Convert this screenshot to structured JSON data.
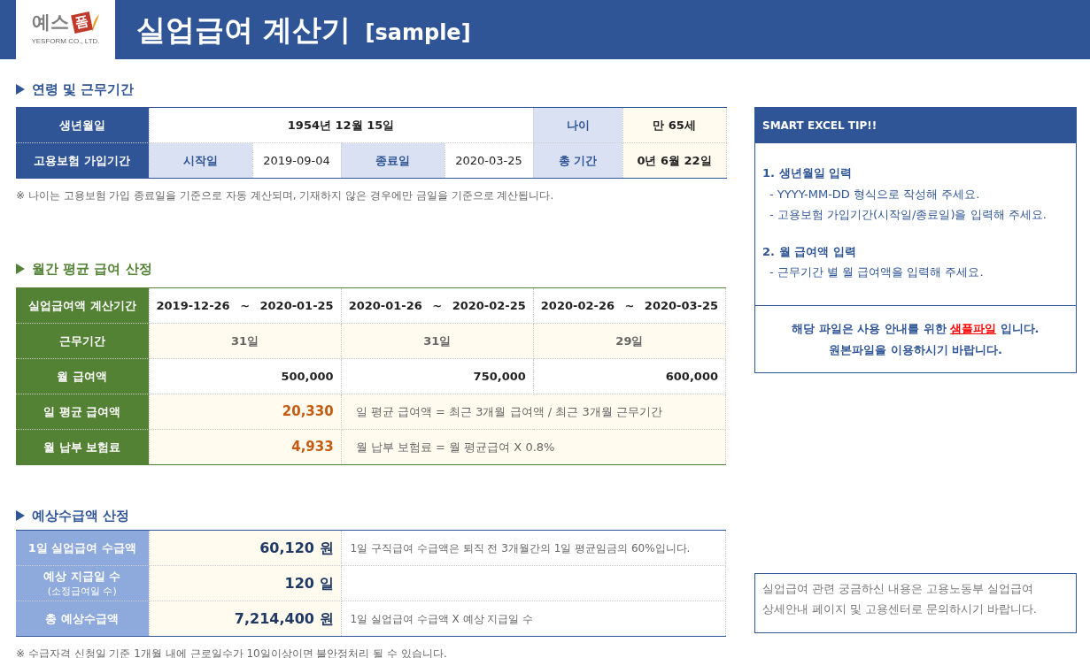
{
  "header": {
    "logo": {
      "text": "예스",
      "stamp": "폼",
      "company": "YESFORM CO., LTD."
    },
    "title": "실업급여 계산기",
    "tag": "[sample]"
  },
  "age_period": {
    "heading": "연령 및 근무기간",
    "birth": {
      "label": "생년월일",
      "value": "1954년 12월 15일"
    },
    "age": {
      "label": "나이",
      "value": "만 65세"
    },
    "period": {
      "label": "고용보험 가입기간",
      "start_label": "시작일",
      "start": "2019-09-04",
      "end_label": "종료일",
      "end": "2020-03-25",
      "total_label": "총 기간",
      "total": "0년 6월 22일"
    },
    "note": "※ 나이는 고용보험 가입 종료일을 기준으로 자동 계산되며, 기재하지 않은 경우에만 금일을 기준으로 계산됩니다."
  },
  "salary": {
    "heading": "월간 평균 급여 산정",
    "period_label": "실업급여액 계산기간",
    "periods": [
      {
        "from": "2019-12-26",
        "sep": "~",
        "to": "2020-01-25"
      },
      {
        "from": "2020-01-26",
        "sep": "~",
        "to": "2020-02-25"
      },
      {
        "from": "2020-02-26",
        "sep": "~",
        "to": "2020-03-25"
      }
    ],
    "days_label": "근무기간",
    "days": [
      "31일",
      "31일",
      "29일"
    ],
    "pay_label": "월 급여액",
    "pay": [
      "500,000",
      "750,000",
      "600,000"
    ],
    "daily_avg": {
      "label": "일 평균 급여액",
      "value": "20,330",
      "formula": "일 평균 급여액 = 최근 3개월 급여액 / 최근 3개월 근무기간"
    },
    "premium": {
      "label": "월 납부 보험료",
      "value": "4,933",
      "formula": "월 납부 보험료 = 월 평균급여 X 0.8%"
    }
  },
  "estimate": {
    "heading": "예상수급액 산정",
    "rows": [
      {
        "label": "1일 실업급여 수급액",
        "value": "60,120 원",
        "desc": "1일 구직급여 수급액은 퇴직 전 3개월간의 1일 평균임금의 60%입니다."
      },
      {
        "label": "예상 지급일 수",
        "sublabel": "(소정급여일 수)",
        "value": "120 일"
      },
      {
        "label": "총 예상수급액",
        "value": "7,214,400 원",
        "desc": "1일 실업급여 수급액 X 예상 지급일 수"
      }
    ],
    "note": "※ 수급자격 신청일 기준 1개월 내에 근로일수가 10일이상이면 불안정처리 될 수 있습니다."
  },
  "tip": {
    "title": "SMART EXCEL TIP!!",
    "items": [
      {
        "heading": "1. 생년월일 입력",
        "lines": [
          "- YYYY-MM-DD 형식으로 작성해 주세요.",
          "- 고용보험 가입기간(시작일/종료일)을 입력해 주세요."
        ]
      },
      {
        "heading": "2. 월 급여액 입력",
        "lines": [
          "- 근무기간 별 월 급여액을 입력해 주세요."
        ]
      }
    ],
    "notice": [
      "해당 파일은 사용 안내를 위한 **샘플파일** 입니다.",
      "원본파일을 이용하시기 바랍니다."
    ]
  },
  "contact": [
    "실업급여 관련 궁금하신 내용은 고용노동부 실업급여",
    "상세안내 페이지 및 고용센터로 문의하시기 바랍니다."
  ]
}
